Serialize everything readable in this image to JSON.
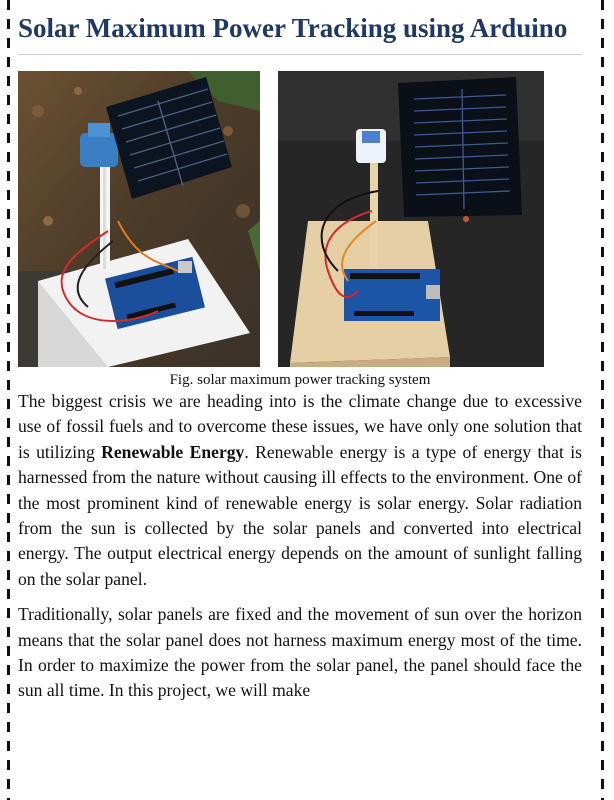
{
  "article": {
    "title": "Solar Maximum Power Tracking using Arduino",
    "figure_caption": "Fig. solar maximum power tracking system",
    "paragraph1": {
      "before": "The biggest crisis we are heading into is the climate change due to excessive use of fossil fuels and to overcome these issues, we have only one solution that is utilizing ",
      "bold": "Renewable Energy",
      "after": ".  Renewable energy is a type of energy that is harnessed from the nature without causing ill effects to the environment. One of the most prominent kind of renewable energy is solar energy. Solar radiation from the sun is collected by the solar panels and converted into electrical energy. The output electrical energy depends on the amount of sunlight falling on the solar panel."
    },
    "paragraph2": "Traditionally, solar panels are fixed and the movement of sun over the horizon means that the solar panel does not harness maximum energy most of the time. In order to maximize the power from the solar panel, the panel should face the sun all time. In this project, we will make"
  }
}
